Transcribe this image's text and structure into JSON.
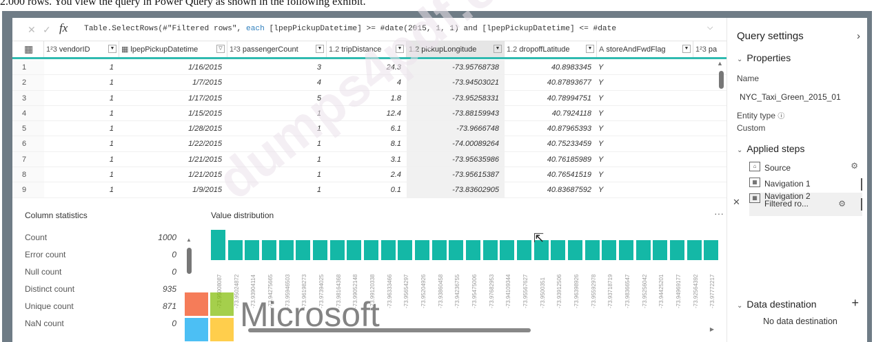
{
  "caption": "2.000 rows. You view the query in Power Query as shown in the following exhibit.",
  "formula": {
    "fx": "fx",
    "text_before": "Table.SelectRows(#\"Filtered rows\", ",
    "keyword": "each",
    "text_after": " [lpepPickupDatetime] >= #date(2015, 1, 1) and [lpepPickupDatetime] <= #date"
  },
  "columns": [
    {
      "type": "1²3",
      "name": "vendorID"
    },
    {
      "type": "▦",
      "name": "lpepPickupDatetime"
    },
    {
      "type": "1²3",
      "name": "passengerCount"
    },
    {
      "type": "1.2",
      "name": "tripDistance"
    },
    {
      "type": "1.2",
      "name": "pickupLongitude"
    },
    {
      "type": "1.2",
      "name": "dropoffLatitude"
    },
    {
      "type": "A",
      "name": "storeAndFwdFlag"
    },
    {
      "type": "1²3",
      "name": "pa"
    }
  ],
  "rows": [
    [
      "1",
      "1",
      "1/16/2015",
      "3",
      "24.3",
      "-73.95768738",
      "40.8983345",
      "Y"
    ],
    [
      "2",
      "1",
      "1/7/2015",
      "4",
      "4",
      "-73.94503021",
      "40.87893677",
      "Y"
    ],
    [
      "3",
      "1",
      "1/17/2015",
      "5",
      "1.8",
      "-73.95258331",
      "40.78994751",
      "Y"
    ],
    [
      "4",
      "1",
      "1/15/2015",
      "1",
      "12.4",
      "-73.88159943",
      "40.7924118",
      "Y"
    ],
    [
      "5",
      "1",
      "1/28/2015",
      "1",
      "6.1",
      "-73.9666748",
      "40.87965393",
      "Y"
    ],
    [
      "6",
      "1",
      "1/22/2015",
      "1",
      "8.1",
      "-74.00089264",
      "40.75233459",
      "Y"
    ],
    [
      "7",
      "1",
      "1/21/2015",
      "1",
      "3.1",
      "-73.95635986",
      "40.76185989",
      "Y"
    ],
    [
      "8",
      "1",
      "1/21/2015",
      "1",
      "2.4",
      "-73.95615387",
      "40.76541519",
      "Y"
    ],
    [
      "9",
      "1",
      "1/9/2015",
      "1",
      "0.1",
      "-73.83602905",
      "40.83687592",
      "Y"
    ]
  ],
  "stats": {
    "title": "Column statistics",
    "items": [
      {
        "label": "Count",
        "value": "1000"
      },
      {
        "label": "Error count",
        "value": "0"
      },
      {
        "label": "Null count",
        "value": "0"
      },
      {
        "label": "Distinct count",
        "value": "935"
      },
      {
        "label": "Unique count",
        "value": "871"
      },
      {
        "label": "NaN count",
        "value": "0"
      }
    ]
  },
  "chart_data": {
    "type": "bar",
    "title": "Value distribution",
    "categories": [
      "-73.95008087",
      "-73.95024872",
      "-73.93904114",
      "-73.94275665",
      "-73.95946503",
      "-73.96198273",
      "-73.97394025",
      "-73.98164368",
      "-73.99052148",
      "-73.99120338",
      "-73.96333466",
      "-73.95654297",
      "-73.95204926",
      "-73.93860458",
      "-73.94236755",
      "-73.95475006",
      "-73.97682953",
      "-73.94109344",
      "-73.95567627",
      "-73.9500351",
      "-73.93912506",
      "-73.96398926",
      "-73.95592978",
      "-73.93718719",
      "-73.98366547",
      "-73.95256042",
      "-73.94425201",
      "-73.94969177",
      "-73.92564392",
      "-73.97772217"
    ],
    "values": [
      3,
      2,
      2,
      2,
      2,
      2,
      2,
      2,
      2,
      2,
      2,
      2,
      2,
      2,
      2,
      2,
      2,
      2,
      2,
      2,
      2,
      2,
      2,
      2,
      2,
      2,
      2,
      2,
      2,
      2
    ],
    "colors": {
      "bar": "#14b8a6"
    }
  },
  "branding": {
    "logo_text": "Microsoft",
    "watermark": "dumps4pdf.com"
  },
  "settings": {
    "title": "Query settings",
    "properties_label": "Properties",
    "name_label": "Name",
    "name_value": "NYC_Taxi_Green_2015_01",
    "entity_type_label": "Entity type",
    "entity_type_value": "Custom",
    "applied_steps_label": "Applied steps",
    "steps": [
      "Source",
      "Navigation 1",
      "Navigation 2",
      "Filtered ro..."
    ],
    "data_destination_label": "Data destination",
    "data_destination_value": "No data destination"
  }
}
